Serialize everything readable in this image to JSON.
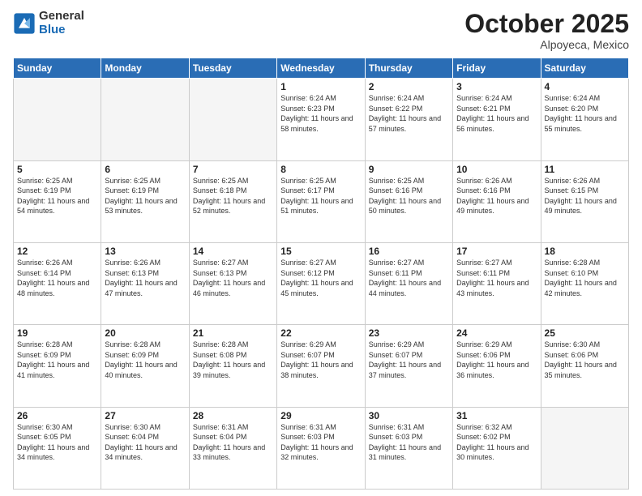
{
  "header": {
    "logo_general": "General",
    "logo_blue": "Blue",
    "month_title": "October 2025",
    "subtitle": "Alpoyeca, Mexico"
  },
  "weekdays": [
    "Sunday",
    "Monday",
    "Tuesday",
    "Wednesday",
    "Thursday",
    "Friday",
    "Saturday"
  ],
  "weeks": [
    [
      {
        "day": "",
        "sunrise": "",
        "sunset": "",
        "daylight": ""
      },
      {
        "day": "",
        "sunrise": "",
        "sunset": "",
        "daylight": ""
      },
      {
        "day": "",
        "sunrise": "",
        "sunset": "",
        "daylight": ""
      },
      {
        "day": "1",
        "sunrise": "6:24 AM",
        "sunset": "6:23 PM",
        "daylight": "11 hours and 58 minutes."
      },
      {
        "day": "2",
        "sunrise": "6:24 AM",
        "sunset": "6:22 PM",
        "daylight": "11 hours and 57 minutes."
      },
      {
        "day": "3",
        "sunrise": "6:24 AM",
        "sunset": "6:21 PM",
        "daylight": "11 hours and 56 minutes."
      },
      {
        "day": "4",
        "sunrise": "6:24 AM",
        "sunset": "6:20 PM",
        "daylight": "11 hours and 55 minutes."
      }
    ],
    [
      {
        "day": "5",
        "sunrise": "6:25 AM",
        "sunset": "6:19 PM",
        "daylight": "11 hours and 54 minutes."
      },
      {
        "day": "6",
        "sunrise": "6:25 AM",
        "sunset": "6:19 PM",
        "daylight": "11 hours and 53 minutes."
      },
      {
        "day": "7",
        "sunrise": "6:25 AM",
        "sunset": "6:18 PM",
        "daylight": "11 hours and 52 minutes."
      },
      {
        "day": "8",
        "sunrise": "6:25 AM",
        "sunset": "6:17 PM",
        "daylight": "11 hours and 51 minutes."
      },
      {
        "day": "9",
        "sunrise": "6:25 AM",
        "sunset": "6:16 PM",
        "daylight": "11 hours and 50 minutes."
      },
      {
        "day": "10",
        "sunrise": "6:26 AM",
        "sunset": "6:16 PM",
        "daylight": "11 hours and 49 minutes."
      },
      {
        "day": "11",
        "sunrise": "6:26 AM",
        "sunset": "6:15 PM",
        "daylight": "11 hours and 49 minutes."
      }
    ],
    [
      {
        "day": "12",
        "sunrise": "6:26 AM",
        "sunset": "6:14 PM",
        "daylight": "11 hours and 48 minutes."
      },
      {
        "day": "13",
        "sunrise": "6:26 AM",
        "sunset": "6:13 PM",
        "daylight": "11 hours and 47 minutes."
      },
      {
        "day": "14",
        "sunrise": "6:27 AM",
        "sunset": "6:13 PM",
        "daylight": "11 hours and 46 minutes."
      },
      {
        "day": "15",
        "sunrise": "6:27 AM",
        "sunset": "6:12 PM",
        "daylight": "11 hours and 45 minutes."
      },
      {
        "day": "16",
        "sunrise": "6:27 AM",
        "sunset": "6:11 PM",
        "daylight": "11 hours and 44 minutes."
      },
      {
        "day": "17",
        "sunrise": "6:27 AM",
        "sunset": "6:11 PM",
        "daylight": "11 hours and 43 minutes."
      },
      {
        "day": "18",
        "sunrise": "6:28 AM",
        "sunset": "6:10 PM",
        "daylight": "11 hours and 42 minutes."
      }
    ],
    [
      {
        "day": "19",
        "sunrise": "6:28 AM",
        "sunset": "6:09 PM",
        "daylight": "11 hours and 41 minutes."
      },
      {
        "day": "20",
        "sunrise": "6:28 AM",
        "sunset": "6:09 PM",
        "daylight": "11 hours and 40 minutes."
      },
      {
        "day": "21",
        "sunrise": "6:28 AM",
        "sunset": "6:08 PM",
        "daylight": "11 hours and 39 minutes."
      },
      {
        "day": "22",
        "sunrise": "6:29 AM",
        "sunset": "6:07 PM",
        "daylight": "11 hours and 38 minutes."
      },
      {
        "day": "23",
        "sunrise": "6:29 AM",
        "sunset": "6:07 PM",
        "daylight": "11 hours and 37 minutes."
      },
      {
        "day": "24",
        "sunrise": "6:29 AM",
        "sunset": "6:06 PM",
        "daylight": "11 hours and 36 minutes."
      },
      {
        "day": "25",
        "sunrise": "6:30 AM",
        "sunset": "6:06 PM",
        "daylight": "11 hours and 35 minutes."
      }
    ],
    [
      {
        "day": "26",
        "sunrise": "6:30 AM",
        "sunset": "6:05 PM",
        "daylight": "11 hours and 34 minutes."
      },
      {
        "day": "27",
        "sunrise": "6:30 AM",
        "sunset": "6:04 PM",
        "daylight": "11 hours and 34 minutes."
      },
      {
        "day": "28",
        "sunrise": "6:31 AM",
        "sunset": "6:04 PM",
        "daylight": "11 hours and 33 minutes."
      },
      {
        "day": "29",
        "sunrise": "6:31 AM",
        "sunset": "6:03 PM",
        "daylight": "11 hours and 32 minutes."
      },
      {
        "day": "30",
        "sunrise": "6:31 AM",
        "sunset": "6:03 PM",
        "daylight": "11 hours and 31 minutes."
      },
      {
        "day": "31",
        "sunrise": "6:32 AM",
        "sunset": "6:02 PM",
        "daylight": "11 hours and 30 minutes."
      },
      {
        "day": "",
        "sunrise": "",
        "sunset": "",
        "daylight": ""
      }
    ]
  ],
  "labels": {
    "sunrise": "Sunrise:",
    "sunset": "Sunset:",
    "daylight": "Daylight:"
  }
}
